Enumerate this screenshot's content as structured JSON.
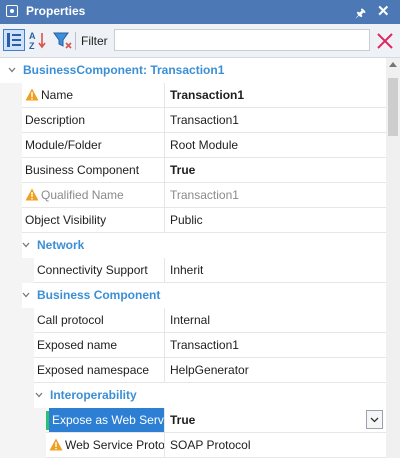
{
  "window": {
    "title": "Properties"
  },
  "toolbar": {
    "filter_label": "Filter",
    "filter_value": "",
    "filter_placeholder": ""
  },
  "grid": {
    "root_category": "BusinessComponent: Transaction1",
    "rows": [
      {
        "name": "Name",
        "value": "Transaction1",
        "warning": true,
        "bold": true
      },
      {
        "name": "Description",
        "value": "Transaction1"
      },
      {
        "name": "Module/Folder",
        "value": "Root Module"
      },
      {
        "name": "Business Component",
        "value": "True",
        "bold": true
      },
      {
        "name": "Qualified Name",
        "value": "Transaction1",
        "warning": true,
        "muted": true
      },
      {
        "name": "Object Visibility",
        "value": "Public"
      }
    ],
    "network": {
      "label": "Network",
      "rows": [
        {
          "name": "Connectivity Support",
          "value": "Inherit"
        }
      ]
    },
    "business_component": {
      "label": "Business Component",
      "rows": [
        {
          "name": "Call protocol",
          "value": "Internal"
        },
        {
          "name": "Exposed name",
          "value": "Transaction1"
        },
        {
          "name": "Exposed namespace",
          "value": "HelpGenerator"
        }
      ],
      "interoperability": {
        "label": "Interoperability",
        "rows": [
          {
            "name": "Expose as Web Servic",
            "value": "True",
            "bold": true,
            "selected": true
          },
          {
            "name": "Web Service Protoc",
            "value": "SOAP Protocol",
            "warning": true
          }
        ]
      }
    }
  }
}
